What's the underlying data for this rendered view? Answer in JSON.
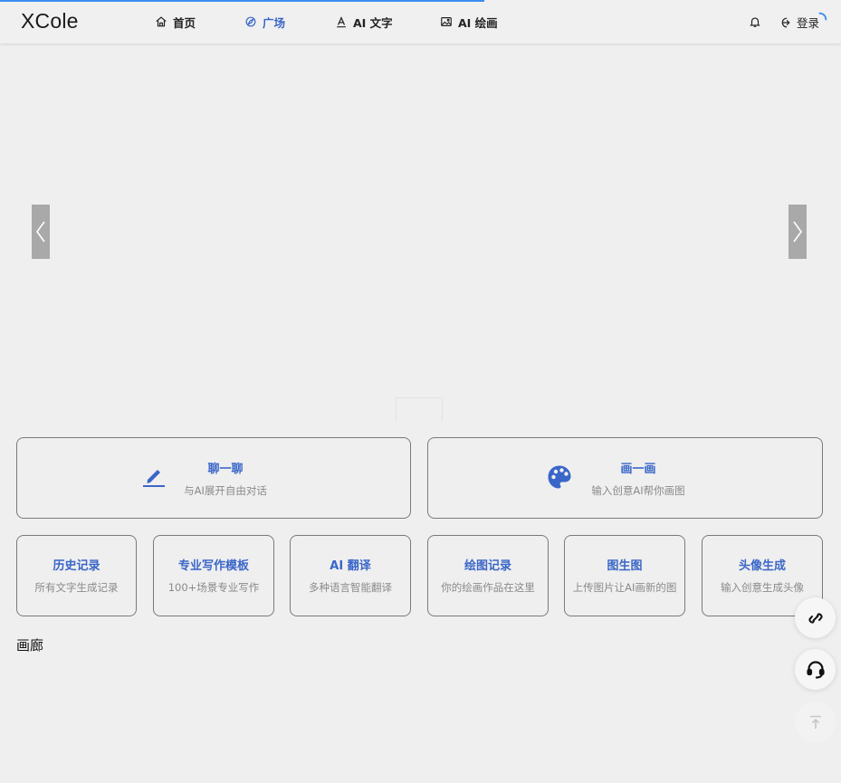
{
  "app": {
    "logo": "XCole"
  },
  "nav": {
    "items": [
      {
        "label": "首页",
        "icon": "home-icon"
      },
      {
        "label": "广场",
        "icon": "square-icon",
        "active": true
      },
      {
        "label": "AI 文字",
        "icon": "text-icon"
      },
      {
        "label": "AI 绘画",
        "icon": "image-icon"
      }
    ],
    "login_label": "登录"
  },
  "colors": {
    "accent": "#3a66c8",
    "progress": "#3b8df0",
    "subtext": "#8a8a8a"
  },
  "features": [
    {
      "title": "聊一聊",
      "desc": "与AI展开自由对话",
      "icon": "edit-icon"
    },
    {
      "title": "画一画",
      "desc": "输入创意AI帮你画图",
      "icon": "palette-icon"
    }
  ],
  "tools": [
    {
      "title": "历史记录",
      "desc": "所有文字生成记录"
    },
    {
      "title": "专业写作模板",
      "desc": "100+场景专业写作"
    },
    {
      "title": "AI 翻译",
      "desc": "多种语言智能翻译"
    },
    {
      "title": "绘图记录",
      "desc": "你的绘画作品在这里"
    },
    {
      "title": "图生图",
      "desc": "上传图片让AI画新的图"
    },
    {
      "title": "头像生成",
      "desc": "输入创意生成头像"
    }
  ],
  "gallery": {
    "title": "画廊"
  },
  "float_buttons": [
    {
      "icon": "link-icon"
    },
    {
      "icon": "headset-icon"
    },
    {
      "icon": "back-to-top-icon"
    }
  ]
}
